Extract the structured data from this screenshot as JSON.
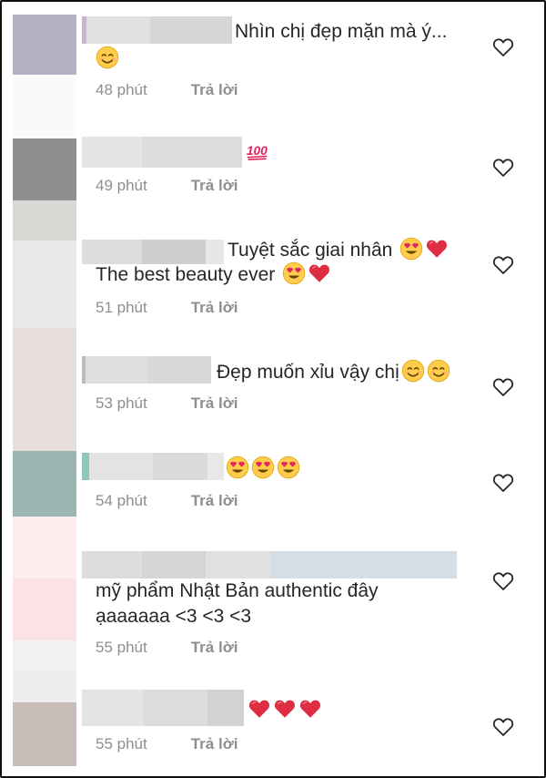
{
  "comments": [
    {
      "text": "Nhìn chị đẹp mặn mà ý...",
      "time": "48 phút",
      "reply": "Trả lời"
    },
    {
      "text": "",
      "time": "49 phút",
      "reply": "Trả lời"
    },
    {
      "text": "Tuyệt sắc giai nhân",
      "text2": "The best beauty ever",
      "time": "51 phút",
      "reply": "Trả lời"
    },
    {
      "text": "Đẹp muốn xỉu vậy chị",
      "time": "53 phút",
      "reply": "Trả lời"
    },
    {
      "text": "",
      "time": "54 phút",
      "reply": "Trả lời"
    },
    {
      "text": "mỹ phẩm Nhật Bản authentic đây",
      "text2": "ạaaaaaa <3 <3 <3",
      "time": "55 phút",
      "reply": "Trả lời"
    },
    {
      "text": "",
      "time": "55 phút",
      "reply": "Trả lời"
    }
  ],
  "colors": {
    "text": "#262626",
    "meta": "#8e8e8e",
    "heart_outline": "#262626"
  },
  "icons": {
    "like": "heart-outline-icon",
    "emoji_smile": "smiling-face-icon",
    "emoji_heart_eyes": "heart-eyes-face-icon",
    "emoji_red_heart": "red-heart-icon",
    "emoji_100": "hundred-points-icon"
  }
}
